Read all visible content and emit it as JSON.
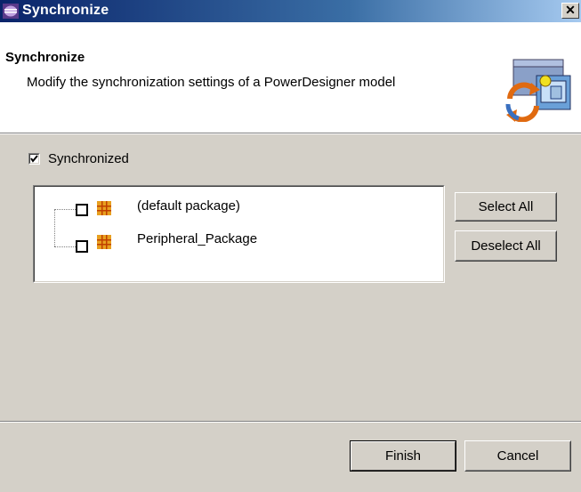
{
  "window": {
    "title": "Synchronize",
    "close_glyph": "✕",
    "app_icon": "eclipse-icon"
  },
  "header": {
    "title": "Synchronize",
    "description": "Modify the synchronization settings of a PowerDesigner model",
    "icon": "synchronize-wizard-icon"
  },
  "synchronized_checkbox": {
    "label": "Synchronized",
    "checked": true
  },
  "tree": {
    "items": [
      {
        "label": "(default package)",
        "checked": false,
        "icon": "package-icon"
      },
      {
        "label": "Peripheral_Package",
        "checked": false,
        "icon": "package-icon"
      }
    ]
  },
  "buttons": {
    "select_all": "Select All",
    "deselect_all": "Deselect All",
    "finish": "Finish",
    "cancel": "Cancel"
  },
  "colors": {
    "title_bar_start": "#0a246a",
    "title_bar_end": "#a6caf0",
    "dialog_bg": "#d4d0c8",
    "package_icon": "#e8a020"
  }
}
